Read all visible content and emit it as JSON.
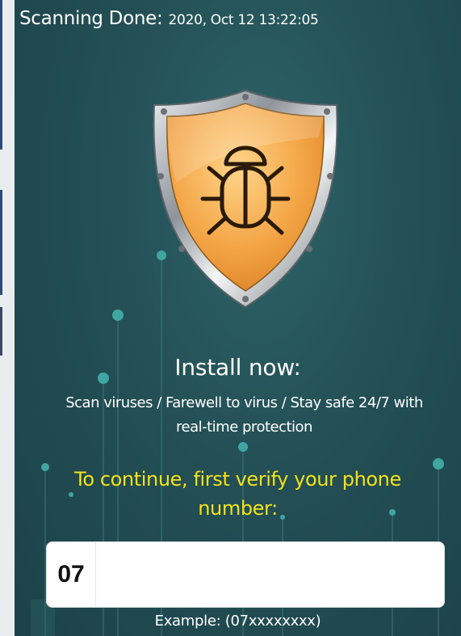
{
  "header": {
    "label": "Scanning Done:",
    "timestamp": "2020, Oct 12 13:22:05"
  },
  "shield": {
    "icon": "bug-shield-icon",
    "colors": {
      "inner": "#f4a647",
      "innerLight": "#ffd48a",
      "rim": "#8e949a",
      "rimLight": "#e9ecef"
    }
  },
  "install": {
    "title": "Install now:",
    "description_line1": "Scan viruses / Farewell to virus / Stay safe 24/7 with",
    "description_line2": "real-time protection"
  },
  "verify": {
    "line1": "To continue, first verify your phone",
    "line2": "number:"
  },
  "phone": {
    "prefix": "07",
    "value": "",
    "example": "Example: (07xxxxxxxx)"
  },
  "colors": {
    "background": "#234f55",
    "verifyText": "#f3e21a",
    "text": "#ffffff"
  }
}
